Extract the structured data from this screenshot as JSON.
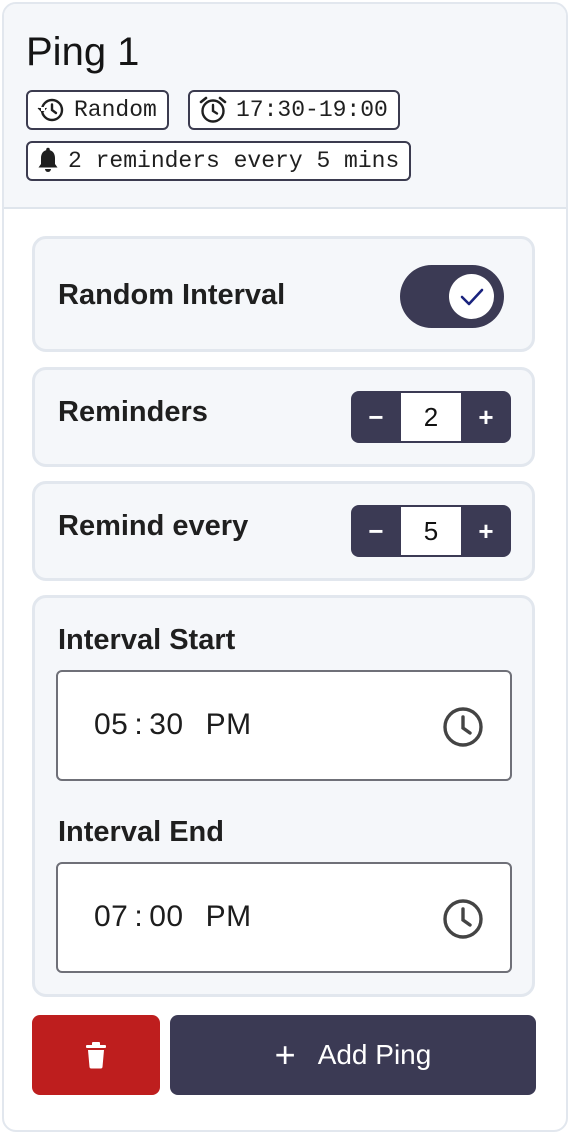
{
  "ping": {
    "title": "Ping 1",
    "chips": {
      "mode": "Random",
      "window": "17:30-19:00",
      "reminders_summary": "2 reminders every 5 mins"
    }
  },
  "random_interval": {
    "label": "Random Interval",
    "enabled": true
  },
  "reminders": {
    "label": "Reminders",
    "minus": "−",
    "value": "2",
    "plus": "+"
  },
  "remind_every": {
    "label": "Remind every",
    "minus": "−",
    "value": "5",
    "plus": "+"
  },
  "interval_start": {
    "label": "Interval Start",
    "hour": "05",
    "sep": ":",
    "minute": "30",
    "ampm": "PM"
  },
  "interval_end": {
    "label": "Interval End",
    "hour": "07",
    "sep": ":",
    "minute": "00",
    "ampm": "PM"
  },
  "actions": {
    "add_label": "Add Ping",
    "add_icon": "+"
  },
  "icons": {
    "mode": "history-icon",
    "window": "alarm-clock-icon",
    "reminders": "bell-icon",
    "toggle": "check-icon",
    "time": "clock-icon",
    "delete": "trash-icon",
    "add": "plus-icon"
  },
  "colors": {
    "accent": "#3b3a54",
    "danger": "#be1e1e",
    "panel_bg": "#f5f7fa"
  }
}
